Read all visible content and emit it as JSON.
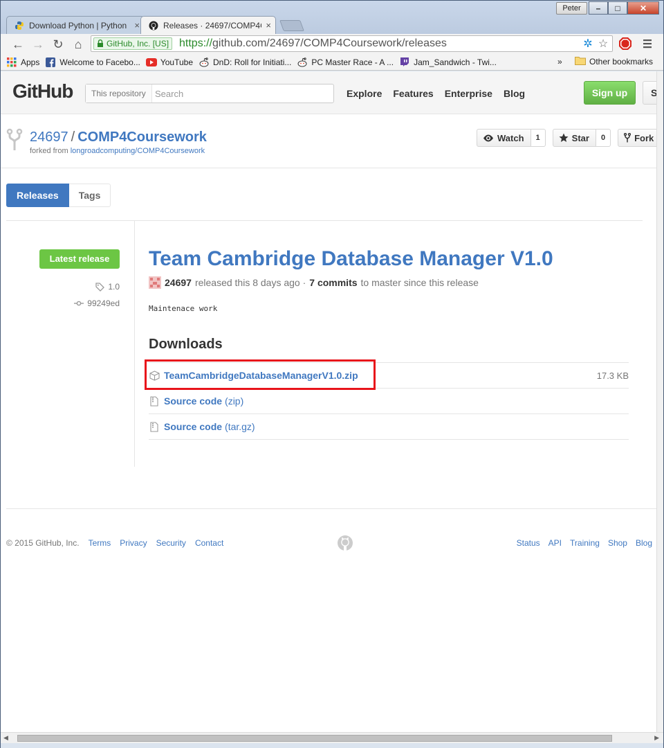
{
  "browser": {
    "profile_name": "Peter",
    "tabs": [
      {
        "title": "Download Python | Python",
        "close": "×"
      },
      {
        "title": "Releases · 24697/COMP4C",
        "close": "×"
      }
    ],
    "ev_badge": "GitHub, Inc. [US]",
    "url_scheme": "https://",
    "url_rest": "github.com/24697/COMP4Coursework/releases",
    "bookmarks": [
      {
        "label": "Apps"
      },
      {
        "label": "Welcome to Facebo..."
      },
      {
        "label": "YouTube"
      },
      {
        "label": "DnD: Roll for Initiati..."
      },
      {
        "label": "PC Master Race - A ..."
      },
      {
        "label": "Jam_Sandwich - Twi..."
      }
    ],
    "bookmarks_overflow": "»",
    "other_bookmarks": "Other bookmarks"
  },
  "github": {
    "logo": "GitHub",
    "search_scope": "This repository",
    "search_placeholder": "Search",
    "nav": [
      "Explore",
      "Features",
      "Enterprise",
      "Blog"
    ],
    "sign_up": "Sign up",
    "sign_in": "Si"
  },
  "repo": {
    "owner": "24697",
    "separator": "/",
    "name": "COMP4Coursework",
    "forked_prefix": "forked from",
    "forked_from": "longroadcomputing/COMP4Coursework",
    "watch_label": "Watch",
    "watch_count": "1",
    "star_label": "Star",
    "star_count": "0",
    "fork_label": "Fork"
  },
  "subnav": {
    "releases": "Releases",
    "tags": "Tags"
  },
  "release": {
    "latest_label": "Latest release",
    "tag": "1.0",
    "commit": "99249ed",
    "title": "Team Cambridge Database Manager V1.0",
    "author": "24697",
    "released_text": "released this 8 days ago ·",
    "commits_count": "7 commits",
    "commits_suffix": "to master since this release",
    "body": "Maintenace work",
    "downloads_heading": "Downloads",
    "downloads": [
      {
        "name": "TeamCambridgeDatabaseManagerV1.0.zip",
        "sub": "",
        "size": "17.3 KB"
      },
      {
        "name": "Source code",
        "sub": "(zip)",
        "size": ""
      },
      {
        "name": "Source code",
        "sub": "(tar.gz)",
        "size": ""
      }
    ]
  },
  "footer": {
    "copyright": "© 2015 GitHub, Inc.",
    "left_links": [
      "Terms",
      "Privacy",
      "Security",
      "Contact"
    ],
    "right_links": [
      "Status",
      "API",
      "Training",
      "Shop",
      "Blog"
    ]
  },
  "colors": {
    "link": "#4078c0",
    "signup": "#6cc644",
    "highlight": "#e8141b"
  }
}
